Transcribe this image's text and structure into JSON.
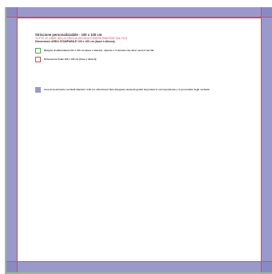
{
  "document": {
    "title": "Striscione personalizzabile - 100 x 100 cm",
    "warning": "TUTTE LE LINEE DELLA GRIGLIA DEVONO ESSERE RIMOSSE DAL FILE",
    "printable_area": "Dimensione AREA STAMPABILE 100 x 100 cm (base x altezza)"
  },
  "legend": {
    "bleed": "Margine di abbondanza 101 x 101 cm (base x altezza) - Questo e' il formato che deve' avere il tuo file",
    "trim": "Dimensione finale 100 x 100 cm (base x altezza)",
    "eyelets": "Area di inserimento occhielli diametro 4.00 cm. Attenzione! Non disegnare elementi grafici importanti in corrispondenza o in prossimita' degli occhielli"
  },
  "colors": {
    "bleed_band": "#9999cc",
    "trim_line": "#e0474c",
    "bleed_outline": "#9bbd8f",
    "legend_green": "#5aaa5a"
  }
}
